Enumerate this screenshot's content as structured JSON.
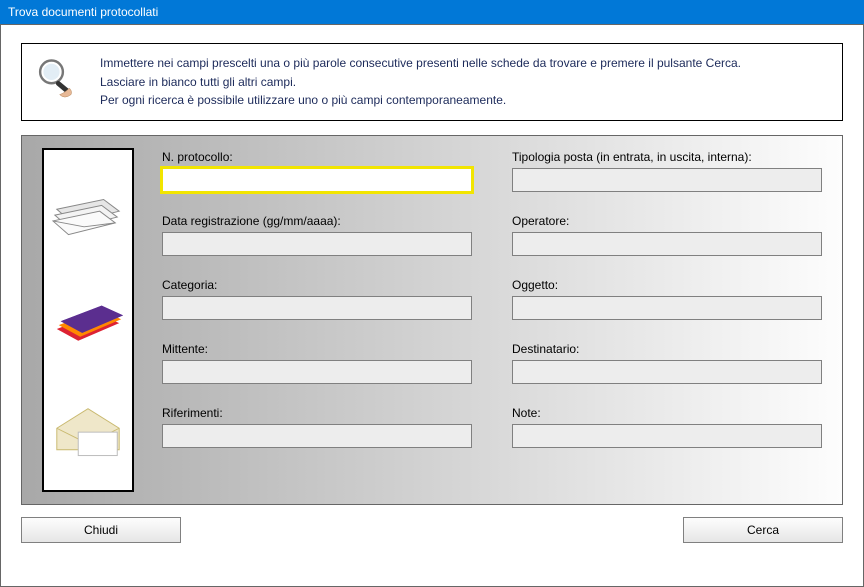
{
  "window": {
    "title": "Trova documenti protocollati"
  },
  "instructions": {
    "line1": "Immettere nei campi prescelti una o più parole consecutive presenti nelle schede da trovare e premere il pulsante Cerca.",
    "line2": "Lasciare in bianco tutti gli altri campi.",
    "line3": "Per ogni ricerca è possibile utilizzare uno o più campi contemporaneamente."
  },
  "fields": {
    "protocollo": {
      "label": "N. protocollo:",
      "value": ""
    },
    "tipologia": {
      "label": "Tipologia posta (in entrata, in uscita, interna):",
      "value": ""
    },
    "data_registrazione": {
      "label": "Data registrazione (gg/mm/aaaa):",
      "value": ""
    },
    "operatore": {
      "label": "Operatore:",
      "value": ""
    },
    "categoria": {
      "label": "Categoria:",
      "value": ""
    },
    "oggetto": {
      "label": "Oggetto:",
      "value": ""
    },
    "mittente": {
      "label": "Mittente:",
      "value": ""
    },
    "destinatario": {
      "label": "Destinatario:",
      "value": ""
    },
    "riferimenti": {
      "label": "Riferimenti:",
      "value": ""
    },
    "note": {
      "label": "Note:",
      "value": ""
    }
  },
  "buttons": {
    "close": "Chiudi",
    "search": "Cerca"
  },
  "icons": {
    "magnifier": "magnifier-hand",
    "thumb1": "envelopes-stack",
    "thumb2": "colored-folders",
    "thumb3": "open-envelope-card"
  }
}
